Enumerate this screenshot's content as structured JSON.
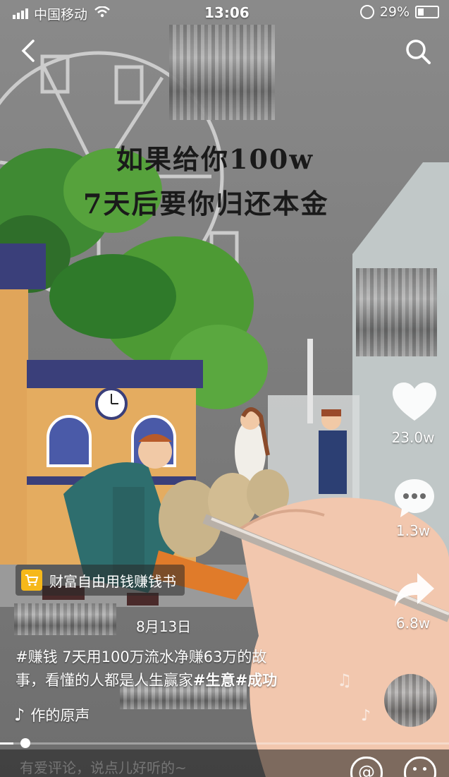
{
  "status_bar": {
    "carrier": "中国移动",
    "time": "13:06",
    "battery": "29%"
  },
  "video": {
    "caption_line1": "如果给你100w",
    "caption_line2": "7天后要你归还本金"
  },
  "side_actions": {
    "likes": "23.0w",
    "comments": "1.3w",
    "shares": "6.8w"
  },
  "product_tag": {
    "label": "财富自由用钱赚钱书"
  },
  "post": {
    "date": "8月13日",
    "description_line1": "#赚钱 7天用100万流水净赚63万的故",
    "description_line2_text": "事，看懂的人都是人生赢家",
    "hashtag_1": "#生意",
    "hashtag_2": "#成功"
  },
  "music": {
    "title": "作的原声"
  },
  "comment_bar": {
    "placeholder": "有爱评论，说点儿好听的~"
  },
  "progress": 0.03
}
